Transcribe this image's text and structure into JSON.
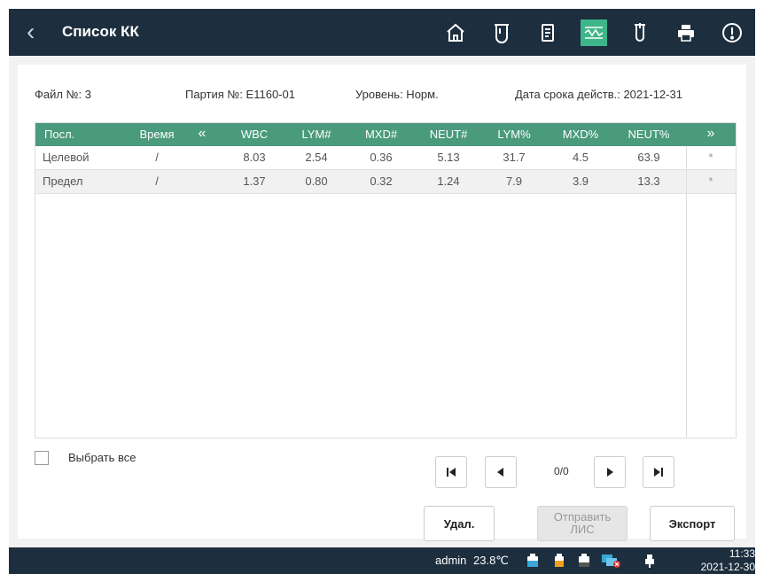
{
  "header": {
    "title": "Список КК"
  },
  "toolbar_icons": [
    "home-icon",
    "test-tube-icon",
    "qc-file-icon",
    "qc-chart-icon",
    "tube-icon",
    "printer-icon",
    "alert-icon"
  ],
  "info": {
    "file": "Файл №:  3",
    "lot": "Партия №:  E1160-01",
    "level": "Уровень:  Норм.",
    "expiry": "Дата срока действ.:  2021-12-31"
  },
  "table": {
    "headers": [
      "Посл.",
      "Время",
      "«",
      "WBC",
      "LYM#",
      "MXD#",
      "NEUT#",
      "LYM%",
      "MXD%",
      "NEUT%",
      "»"
    ],
    "rows": [
      {
        "name": "Целевой",
        "time": "/",
        "wbc": "8.03",
        "lym_n": "2.54",
        "mxd_n": "0.36",
        "neut_n": "5.13",
        "lym_p": "31.7",
        "mxd_p": "4.5",
        "neut_p": "63.9",
        "flag": "*"
      },
      {
        "name": "Предел",
        "time": "/",
        "wbc": "1.37",
        "lym_n": "0.80",
        "mxd_n": "0.32",
        "neut_n": "1.24",
        "lym_p": "7.9",
        "mxd_p": "3.9",
        "neut_p": "13.3",
        "flag": "*"
      }
    ]
  },
  "select_all": "Выбрать все",
  "pagination": "0/0",
  "buttons": {
    "delete": "Удал.",
    "send_line1": "Отправить",
    "send_line2": "ЛИС",
    "export": "Экспорт"
  },
  "status": {
    "user": "admin",
    "temp": "23.8℃",
    "time": "11:33",
    "date": "2021-12-30"
  },
  "colors": {
    "topbar": "#1d2e3e",
    "accent": "#3fb58a",
    "table_header": "#4a9a7d"
  }
}
